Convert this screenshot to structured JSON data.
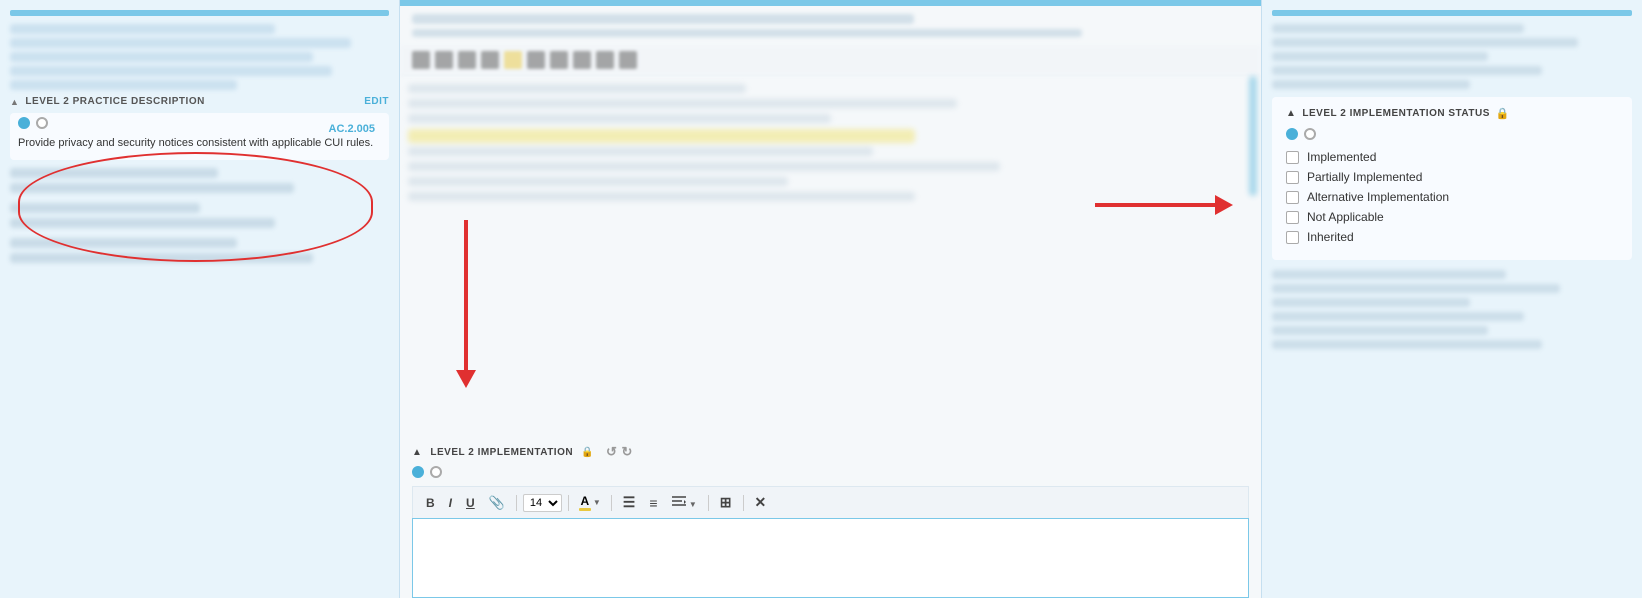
{
  "left_panel": {
    "header_label": "LEVEL 2 PRACTICE DESCRIPTION",
    "edit_label": "Edit",
    "practice_code": "AC.2.005",
    "radio_filled": true,
    "description": "Provide privacy and security notices consistent with applicable CUI rules.",
    "blurred_sections": [
      "LEVEL 1 PRACTICE DESCRIPTION",
      "LEVEL 3 PRACTICE DESCRIPTION",
      "LEVEL 4 PRACTICE DESCRIPTION"
    ]
  },
  "middle_panel": {
    "blurred_header": "LEVEL 2 IMPLEMENTATION",
    "toolbar_icons": [
      "B",
      "I",
      "U",
      "clip",
      "A",
      "list-ul",
      "list-ol",
      "align",
      "table",
      "times"
    ],
    "font_size": "14",
    "impl_section_label": "LEVEL 2 IMPLEMENTATION",
    "undo_symbol": "↺",
    "redo_symbol": "↻",
    "rich_text_buttons": [
      "B",
      "I",
      "U",
      "📎"
    ],
    "font_size_option": "14",
    "color_label": "A",
    "list_ul": "☰",
    "list_ol": "≡",
    "align": "≡",
    "table": "⊞",
    "clear": "✕"
  },
  "right_panel": {
    "impl_status_header": "LEVEL 2 IMPLEMENTATION STATUS",
    "lock_icon": "🔒",
    "options": [
      {
        "label": "Implemented",
        "checked": false
      },
      {
        "label": "Partially Implemented",
        "checked": false
      },
      {
        "label": "Alternative Implementation",
        "checked": false
      },
      {
        "label": "Not Applicable",
        "checked": false
      },
      {
        "label": "Inherited",
        "checked": false
      }
    ],
    "blurred_sections": [
      "LEVEL 1 IMPLEMENTATION STATUS",
      "LEVEL 3 IMPLEMENTATION STATUS",
      "LEVEL 4 IMPLEMENTATION STATUS"
    ]
  },
  "annotations": {
    "detected_text_1": "Partially Implemented",
    "detected_text_2": "Alternative Implementation Not Applicable"
  }
}
